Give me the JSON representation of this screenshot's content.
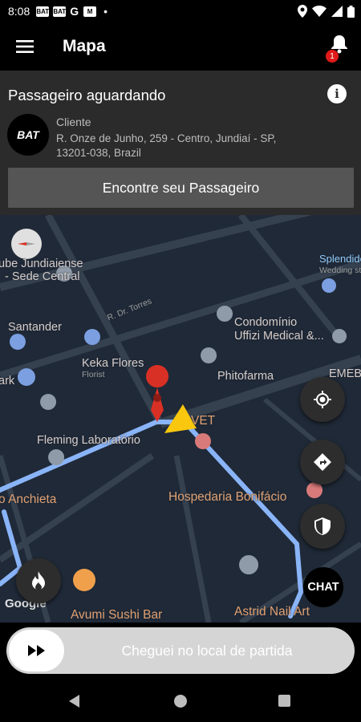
{
  "status_bar": {
    "time": "8:08",
    "notification_icons": [
      "BAT",
      "BAT",
      "G",
      "M"
    ],
    "right_icons": [
      "location-icon",
      "wifi-icon",
      "signal-icon",
      "battery-icon"
    ]
  },
  "app_bar": {
    "title": "Mapa",
    "notification_count": "1"
  },
  "passenger_card": {
    "title": "Passageiro aguardando",
    "avatar_text": "BAT",
    "client_label": "Cliente",
    "address": "R. Onze de Junho, 259 - Centro, Jundiaí - SP, 13201-038, Brazil",
    "find_button": "Encontre seu Passageiro"
  },
  "map": {
    "labels": {
      "clube": "ube Jundiaiense",
      "sede": "- Sede Central",
      "santander": "Santander",
      "splendido": "Splendido",
      "wedding": "Wedding st",
      "condominio1": "Condomínio",
      "condominio2": "Uffizi Medical &...",
      "keka": "Keka Flores",
      "florist": "Florist",
      "phitofarma": "Phitofarma",
      "emeb": "EMEB",
      "park": "ark",
      "fleming": "Fleming Laboratório",
      "vet": "VET",
      "anchieta": "o Anchieta",
      "hospedaria": "Hospedaria Bonifácio",
      "avumi": "Avumi Sushi Bar",
      "astrid": "Astrid Nail Art",
      "street": "R. Dr. Torres"
    },
    "google_logo": "Google",
    "chat_label": "CHAT"
  },
  "slider": {
    "label": "Cheguei no local de partida"
  },
  "colors": {
    "accent_route": "#8ab4f8",
    "marker_red": "#d93025",
    "arrow_yellow": "#f9c80e",
    "badge_red": "#e01a1a"
  }
}
